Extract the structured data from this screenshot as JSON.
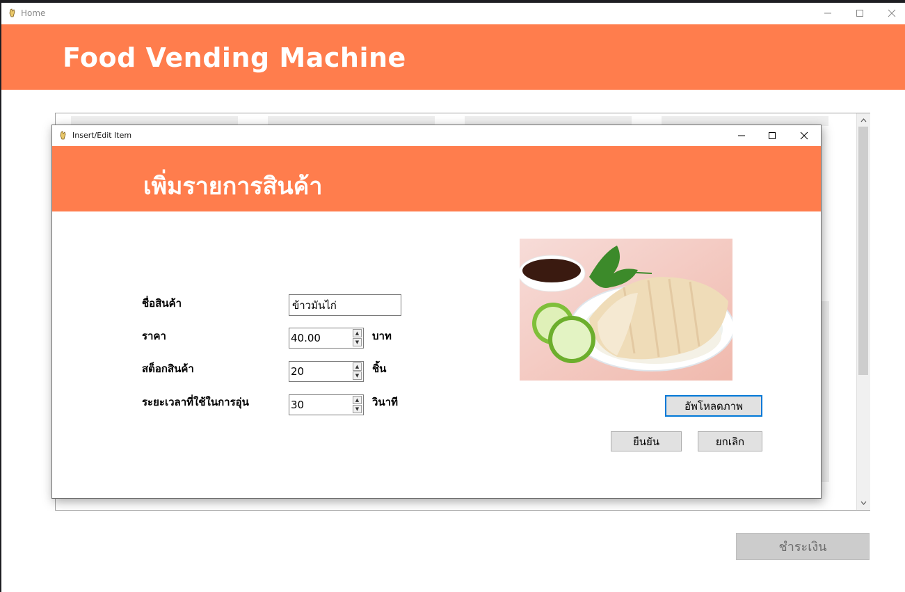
{
  "main_window": {
    "title": "Home",
    "banner_title": "Food Vending Machine",
    "pay_button_label": "ชำระเงิน"
  },
  "dialog": {
    "title": "Insert/Edit Item",
    "heading": "เพิ่มรายการสินค้า",
    "fields": {
      "name": {
        "label": "ชื่อสินค้า",
        "value": "ข้าวมันไก่"
      },
      "price": {
        "label": "ราคา",
        "value": "40.00",
        "unit": "บาท"
      },
      "stock": {
        "label": "สต็อกสินค้า",
        "value": "20",
        "unit": "ชิ้น"
      },
      "heat_time": {
        "label": "ระยะเวลาที่ใช้ในการอุ่น",
        "value": "30",
        "unit": "วินาที"
      }
    },
    "upload_button_label": "อัพโหลดภาพ",
    "confirm_button_label": "ยืนยัน",
    "cancel_button_label": "ยกเลิก",
    "image_icon": "food-photo"
  },
  "colors": {
    "banner": "#ff7d4d",
    "focus": "#0078d7"
  }
}
